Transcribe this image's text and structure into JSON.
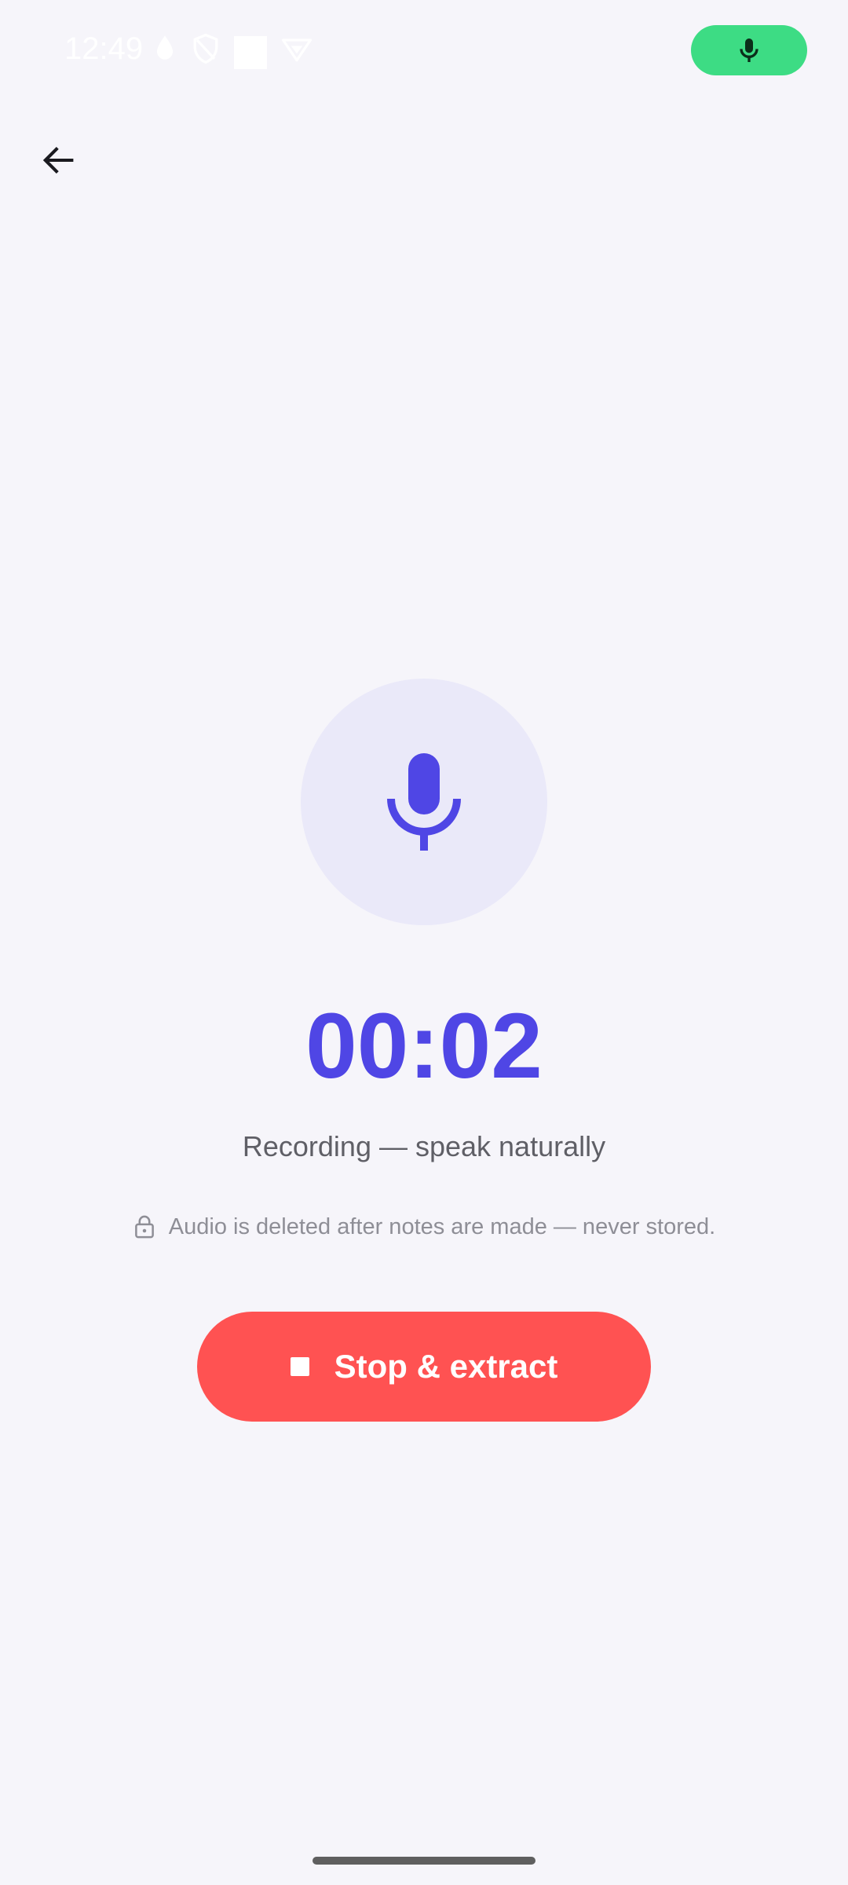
{
  "status_bar": {
    "time": "12:49",
    "icons": [
      "drop-icon",
      "shield-icon",
      "square-icon",
      "vpn-icon"
    ],
    "mic_indicator": "mic-icon"
  },
  "app_bar": {
    "back_icon": "arrow-back-icon"
  },
  "recorder": {
    "mic_icon": "microphone-icon",
    "timer": "00:02",
    "status": "Recording — speak naturally",
    "privacy_icon": "lock-icon",
    "privacy_note": "Audio is deleted after notes are made — never stored.",
    "stop_button_label": "Stop & extract",
    "stop_icon": "stop-icon"
  },
  "colors": {
    "background": "#F6F5FA",
    "accent": "#4F46E5",
    "accent_light": "#EAE9F9",
    "danger": "#FF5252",
    "status_pill": "#3DDC84"
  }
}
